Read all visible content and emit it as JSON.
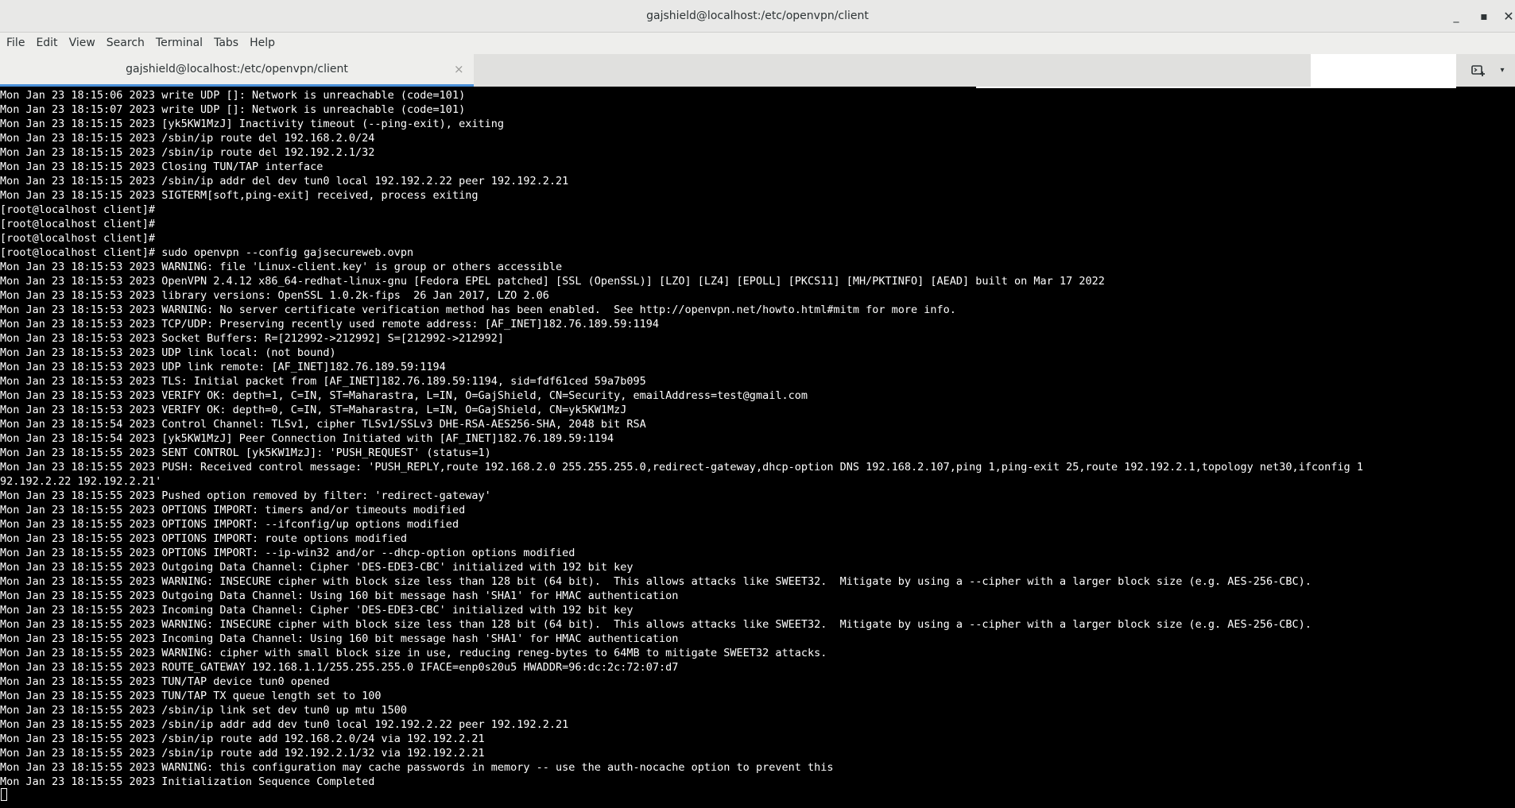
{
  "window": {
    "title": "gajshield@localhost:/etc/openvpn/client",
    "minimize_glyph": "_",
    "maximize_glyph": "▪",
    "close_glyph": "✕"
  },
  "menubar": {
    "items": [
      "File",
      "Edit",
      "View",
      "Search",
      "Terminal",
      "Tabs",
      "Help"
    ]
  },
  "tabs": {
    "active": {
      "label": "gajshield@localhost:/etc/openvpn/client",
      "close_glyph": "×"
    },
    "new_tab_icon": "new-terminal-tab-icon",
    "menu_glyph": "▾"
  },
  "colors": {
    "terminal_bg": "#000000",
    "terminal_fg": "#ffffff",
    "chrome_bg": "#eeeeec",
    "tab_accent": "#4a90d9"
  },
  "terminal": {
    "lines": [
      "Mon Jan 23 18:15:06 2023 write UDP []: Network is unreachable (code=101)",
      "Mon Jan 23 18:15:07 2023 write UDP []: Network is unreachable (code=101)",
      "Mon Jan 23 18:15:15 2023 [yk5KW1MzJ] Inactivity timeout (--ping-exit), exiting",
      "Mon Jan 23 18:15:15 2023 /sbin/ip route del 192.168.2.0/24",
      "Mon Jan 23 18:15:15 2023 /sbin/ip route del 192.192.2.1/32",
      "Mon Jan 23 18:15:15 2023 Closing TUN/TAP interface",
      "Mon Jan 23 18:15:15 2023 /sbin/ip addr del dev tun0 local 192.192.2.22 peer 192.192.2.21",
      "Mon Jan 23 18:15:15 2023 SIGTERM[soft,ping-exit] received, process exiting",
      "[root@localhost client]#",
      "[root@localhost client]#",
      "[root@localhost client]#",
      "[root@localhost client]# sudo openvpn --config gajsecureweb.ovpn",
      "Mon Jan 23 18:15:53 2023 WARNING: file 'Linux-client.key' is group or others accessible",
      "Mon Jan 23 18:15:53 2023 OpenVPN 2.4.12 x86_64-redhat-linux-gnu [Fedora EPEL patched] [SSL (OpenSSL)] [LZO] [LZ4] [EPOLL] [PKCS11] [MH/PKTINFO] [AEAD] built on Mar 17 2022",
      "Mon Jan 23 18:15:53 2023 library versions: OpenSSL 1.0.2k-fips  26 Jan 2017, LZO 2.06",
      "Mon Jan 23 18:15:53 2023 WARNING: No server certificate verification method has been enabled.  See http://openvpn.net/howto.html#mitm for more info.",
      "Mon Jan 23 18:15:53 2023 TCP/UDP: Preserving recently used remote address: [AF_INET]182.76.189.59:1194",
      "Mon Jan 23 18:15:53 2023 Socket Buffers: R=[212992->212992] S=[212992->212992]",
      "Mon Jan 23 18:15:53 2023 UDP link local: (not bound)",
      "Mon Jan 23 18:15:53 2023 UDP link remote: [AF_INET]182.76.189.59:1194",
      "Mon Jan 23 18:15:53 2023 TLS: Initial packet from [AF_INET]182.76.189.59:1194, sid=fdf61ced 59a7b095",
      "Mon Jan 23 18:15:53 2023 VERIFY OK: depth=1, C=IN, ST=Maharastra, L=IN, O=GajShield, CN=Security, emailAddress=test@gmail.com",
      "Mon Jan 23 18:15:53 2023 VERIFY OK: depth=0, C=IN, ST=Maharastra, L=IN, O=GajShield, CN=yk5KW1MzJ",
      "Mon Jan 23 18:15:54 2023 Control Channel: TLSv1, cipher TLSv1/SSLv3 DHE-RSA-AES256-SHA, 2048 bit RSA",
      "Mon Jan 23 18:15:54 2023 [yk5KW1MzJ] Peer Connection Initiated with [AF_INET]182.76.189.59:1194",
      "Mon Jan 23 18:15:55 2023 SENT CONTROL [yk5KW1MzJ]: 'PUSH_REQUEST' (status=1)",
      "Mon Jan 23 18:15:55 2023 PUSH: Received control message: 'PUSH_REPLY,route 192.168.2.0 255.255.255.0,redirect-gateway,dhcp-option DNS 192.168.2.107,ping 1,ping-exit 25,route 192.192.2.1,topology net30,ifconfig 1",
      "92.192.2.22 192.192.2.21'",
      "Mon Jan 23 18:15:55 2023 Pushed option removed by filter: 'redirect-gateway'",
      "Mon Jan 23 18:15:55 2023 OPTIONS IMPORT: timers and/or timeouts modified",
      "Mon Jan 23 18:15:55 2023 OPTIONS IMPORT: --ifconfig/up options modified",
      "Mon Jan 23 18:15:55 2023 OPTIONS IMPORT: route options modified",
      "Mon Jan 23 18:15:55 2023 OPTIONS IMPORT: --ip-win32 and/or --dhcp-option options modified",
      "Mon Jan 23 18:15:55 2023 Outgoing Data Channel: Cipher 'DES-EDE3-CBC' initialized with 192 bit key",
      "Mon Jan 23 18:15:55 2023 WARNING: INSECURE cipher with block size less than 128 bit (64 bit).  This allows attacks like SWEET32.  Mitigate by using a --cipher with a larger block size (e.g. AES-256-CBC).",
      "Mon Jan 23 18:15:55 2023 Outgoing Data Channel: Using 160 bit message hash 'SHA1' for HMAC authentication",
      "Mon Jan 23 18:15:55 2023 Incoming Data Channel: Cipher 'DES-EDE3-CBC' initialized with 192 bit key",
      "Mon Jan 23 18:15:55 2023 WARNING: INSECURE cipher with block size less than 128 bit (64 bit).  This allows attacks like SWEET32.  Mitigate by using a --cipher with a larger block size (e.g. AES-256-CBC).",
      "Mon Jan 23 18:15:55 2023 Incoming Data Channel: Using 160 bit message hash 'SHA1' for HMAC authentication",
      "Mon Jan 23 18:15:55 2023 WARNING: cipher with small block size in use, reducing reneg-bytes to 64MB to mitigate SWEET32 attacks.",
      "Mon Jan 23 18:15:55 2023 ROUTE_GATEWAY 192.168.1.1/255.255.255.0 IFACE=enp0s20u5 HWADDR=96:dc:2c:72:07:d7",
      "Mon Jan 23 18:15:55 2023 TUN/TAP device tun0 opened",
      "Mon Jan 23 18:15:55 2023 TUN/TAP TX queue length set to 100",
      "Mon Jan 23 18:15:55 2023 /sbin/ip link set dev tun0 up mtu 1500",
      "Mon Jan 23 18:15:55 2023 /sbin/ip addr add dev tun0 local 192.192.2.22 peer 192.192.2.21",
      "Mon Jan 23 18:15:55 2023 /sbin/ip route add 192.168.2.0/24 via 192.192.2.21",
      "Mon Jan 23 18:15:55 2023 /sbin/ip route add 192.192.2.1/32 via 192.192.2.21",
      "Mon Jan 23 18:15:55 2023 WARNING: this configuration may cache passwords in memory -- use the auth-nocache option to prevent this",
      "Mon Jan 23 18:15:55 2023 Initialization Sequence Completed"
    ]
  }
}
